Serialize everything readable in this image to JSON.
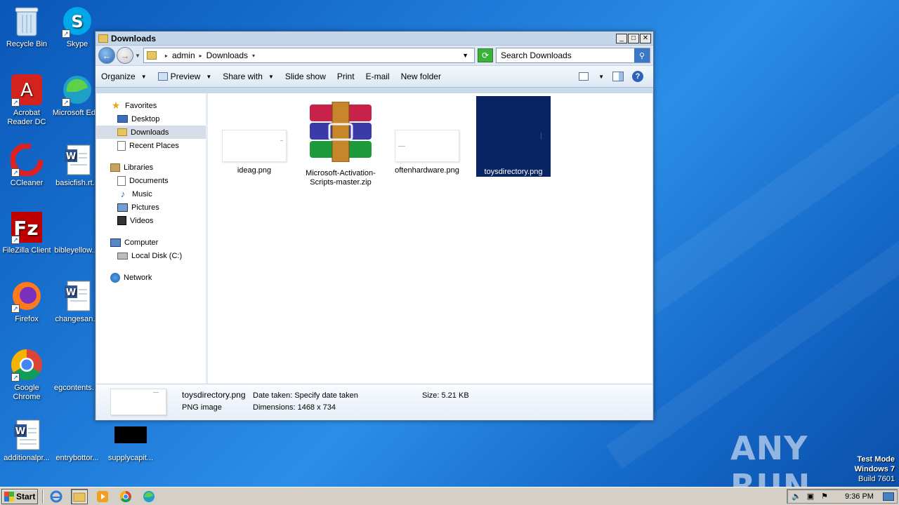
{
  "desktop": {
    "icons": [
      {
        "label": "Recycle Bin",
        "icon": "recycle-bin-icon"
      },
      {
        "label": "Skype",
        "icon": "skype-icon"
      },
      {
        "label": "Acrobat Reader DC",
        "icon": "acrobat-icon"
      },
      {
        "label": "Microsoft Ed...",
        "icon": "edge-icon"
      },
      {
        "label": "CCleaner",
        "icon": "ccleaner-icon"
      },
      {
        "label": "basicfish.rt...",
        "icon": "word-doc-icon"
      },
      {
        "label": "FileZilla Client",
        "icon": "filezilla-icon"
      },
      {
        "label": "bibleyellow....",
        "icon": "blank-file-icon"
      },
      {
        "label": "Firefox",
        "icon": "firefox-icon"
      },
      {
        "label": "changesan...",
        "icon": "word-doc-icon"
      },
      {
        "label": "Google Chrome",
        "icon": "chrome-icon"
      },
      {
        "label": "egcontents....",
        "icon": "blank-file-icon"
      },
      {
        "label": "additionalpr...",
        "icon": "word-doc-icon"
      },
      {
        "label": "entrybottor...",
        "icon": "blank-file-icon"
      },
      {
        "label": "supplycapit...",
        "icon": "black-image-icon"
      }
    ]
  },
  "window": {
    "title": "Downloads",
    "address": {
      "crumbs": [
        "admin",
        "Downloads"
      ]
    },
    "search_placeholder": "Search Downloads",
    "toolbar": {
      "organize": "Organize",
      "preview": "Preview",
      "share_with": "Share with",
      "slide_show": "Slide show",
      "print": "Print",
      "email": "E-mail",
      "new_folder": "New folder"
    },
    "nav": {
      "favorites": "Favorites",
      "desktop": "Desktop",
      "downloads": "Downloads",
      "recent_places": "Recent Places",
      "libraries": "Libraries",
      "documents": "Documents",
      "music": "Music",
      "pictures": "Pictures",
      "videos": "Videos",
      "computer": "Computer",
      "local_disk": "Local Disk (C:)",
      "network": "Network"
    },
    "files": [
      {
        "name": "ideag.png",
        "type": "png"
      },
      {
        "name": "Microsoft-Activation-Scripts-master.zip",
        "type": "zip"
      },
      {
        "name": "oftenhardware.png",
        "type": "png"
      },
      {
        "name": "toysdirectory.png",
        "type": "png",
        "selected": true
      }
    ],
    "details": {
      "name": "toysdirectory.png",
      "type": "PNG image",
      "date_taken": "Date taken: Specify date taken",
      "dimensions": "Dimensions: 1468 x 734",
      "size": "Size: 5.21 KB"
    }
  },
  "taskbar": {
    "start": "Start",
    "clock": "9:36 PM"
  },
  "watermark": "ANY RUN",
  "test_mode": {
    "line1": "Test Mode",
    "line2": "Windows 7",
    "line3": "Build 7601"
  }
}
